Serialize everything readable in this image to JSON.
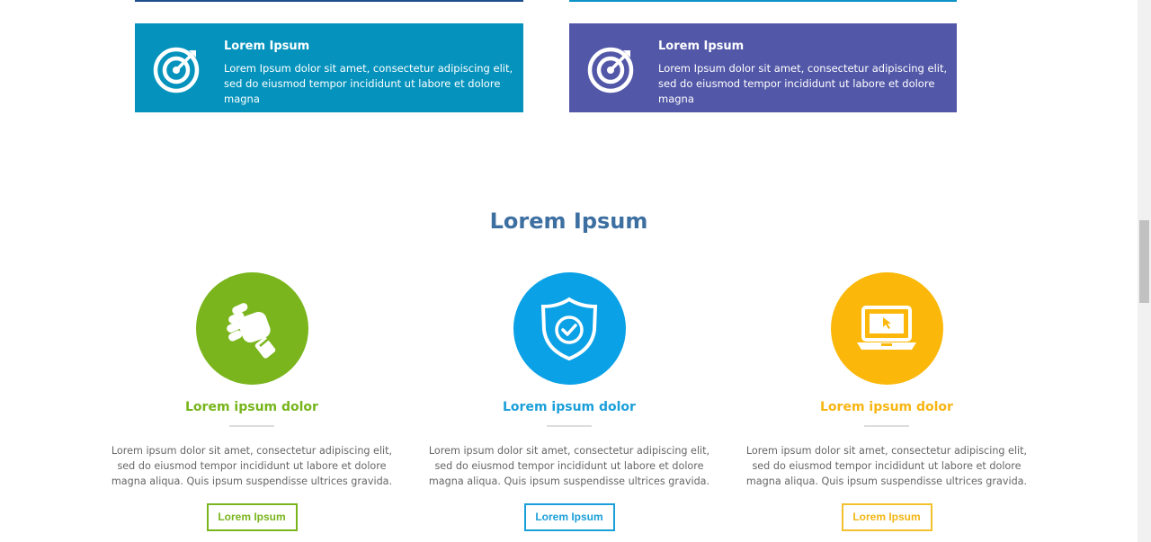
{
  "cards": [
    {
      "icon": "target-icon",
      "title": "Lorem Ipsum",
      "text": "Lorem Ipsum dolor sit amet, consectetur adipiscing elit, sed do eiusmod tempor incididunt ut labore et dolore magna",
      "color": "#0593bd"
    },
    {
      "icon": "target-icon",
      "title": "Lorem Ipsum",
      "text": "Lorem Ipsum dolor sit amet, consectetur adipiscing elit, sed do eiusmod tempor incididunt ut labore et dolore magna",
      "color": "#5257a8"
    }
  ],
  "section": {
    "title": "Lorem Ipsum"
  },
  "columns": [
    {
      "icon": "fist-icon",
      "title": "Lorem ipsum dolor",
      "text": "Lorem ipsum dolor sit amet, consectetur adipiscing elit, sed do eiusmod tempor incididunt ut labore et dolore magna aliqua. Quis ipsum suspendisse ultrices gravida.",
      "button_label": "Lorem Ipsum",
      "color": "#7ab51d"
    },
    {
      "icon": "shield-check-icon",
      "title": "Lorem ipsum dolor",
      "text": "Lorem ipsum dolor sit amet, consectetur adipiscing elit, sed do eiusmod tempor incididunt ut labore et dolore magna aliqua. Quis ipsum suspendisse ultrices gravida.",
      "button_label": "Lorem Ipsum",
      "color": "#0aa1e6"
    },
    {
      "icon": "laptop-icon",
      "title": "Lorem ipsum dolor",
      "text": "Lorem ipsum dolor sit amet, consectetur adipiscing elit, sed do eiusmod tempor incididunt ut labore et dolore magna aliqua. Quis ipsum suspendisse ultrices gravida.",
      "button_label": "Lorem Ipsum",
      "color": "#fbb80b"
    }
  ]
}
